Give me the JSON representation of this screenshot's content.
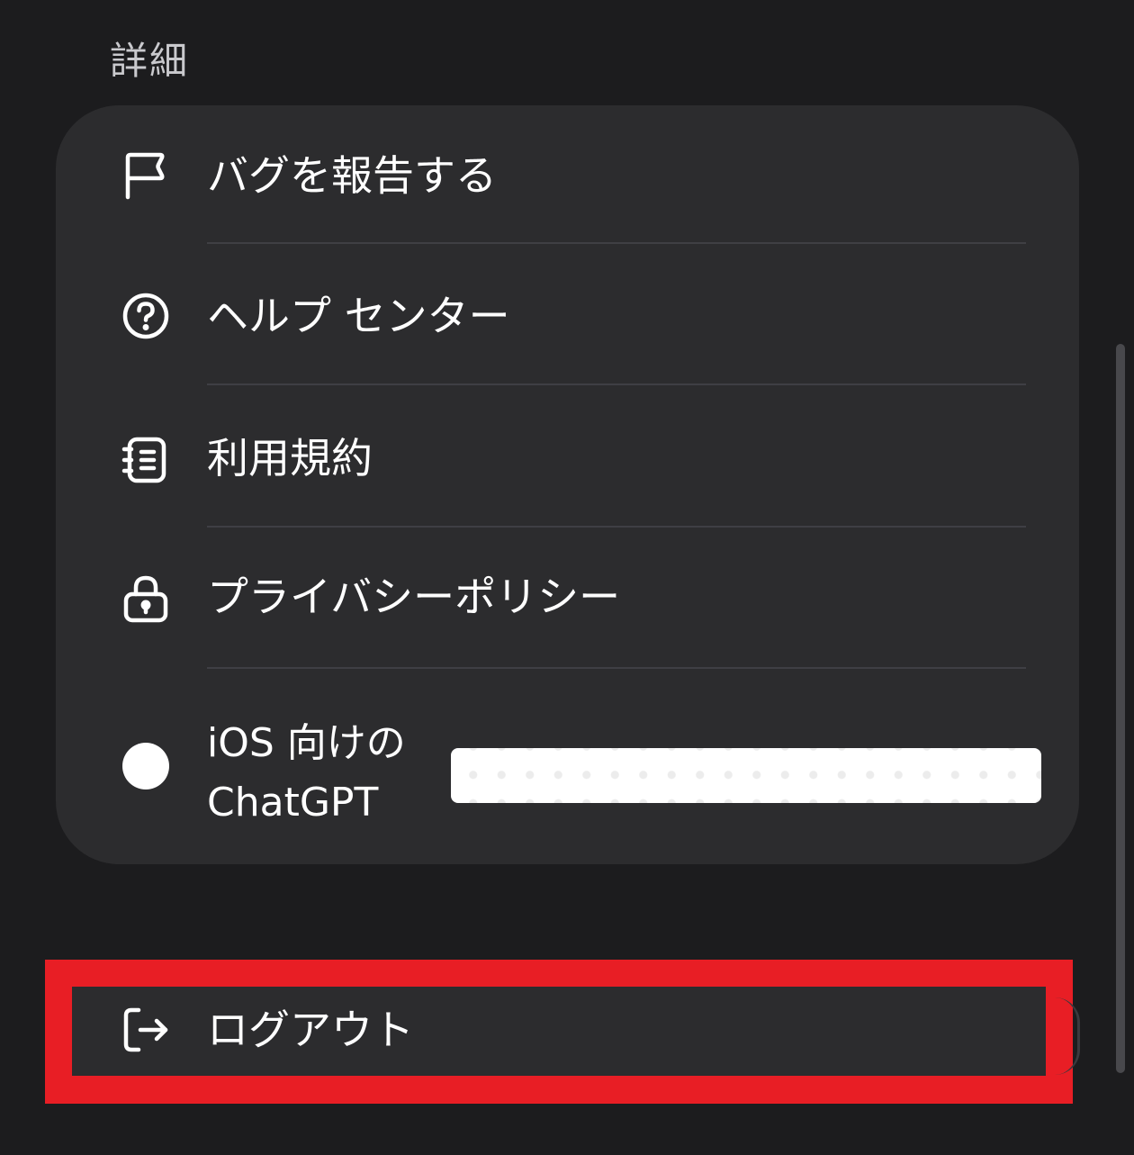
{
  "section": {
    "title": "詳細"
  },
  "menu": {
    "items": [
      {
        "label": "バグを報告する",
        "icon": "flag-icon"
      },
      {
        "label": "ヘルプ センター",
        "icon": "question-circle-icon"
      },
      {
        "label": "利用規約",
        "icon": "notebook-icon"
      },
      {
        "label": "プライバシーポリシー",
        "icon": "lock-icon"
      }
    ],
    "version": {
      "label_line1": "iOS 向けの",
      "label_line2": "ChatGPT",
      "icon": "dot-icon"
    }
  },
  "logout": {
    "label": "ログアウト",
    "icon": "logout-arrow-icon",
    "highlight_color": "#e81e25"
  },
  "colors": {
    "background": "#1c1c1e",
    "card": "#2c2c2e",
    "divider": "#3f3f44",
    "header_text": "#c9c9cd"
  }
}
